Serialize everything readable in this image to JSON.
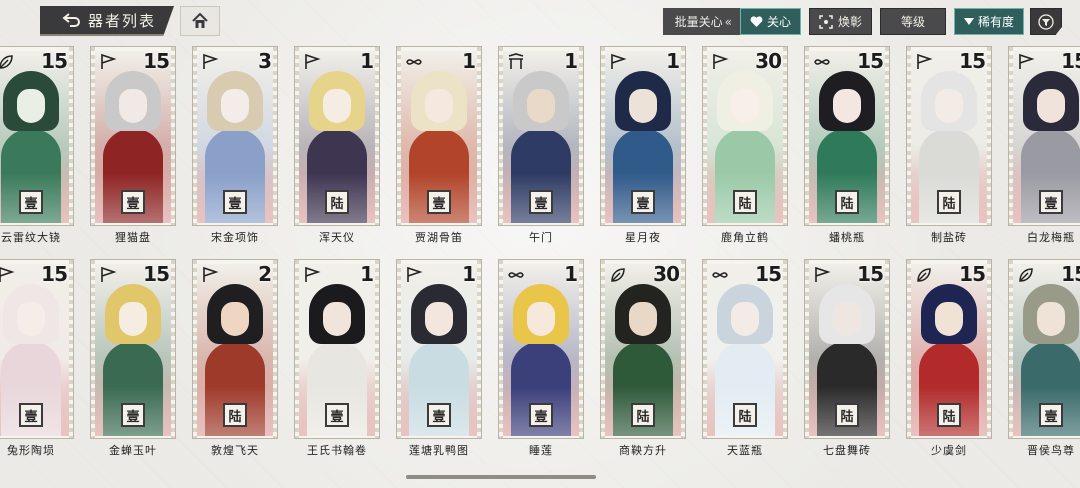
{
  "header": {
    "title": "器者列表",
    "batch_label": "批量关心",
    "batch_chevron": "«",
    "fav_label": "关心",
    "swap_label": "焕彰",
    "level_label": "等级",
    "rarity_label": "稀有度"
  },
  "icons": {
    "back": "back-arrow-icon",
    "home": "home-icon",
    "heart": "heart-icon",
    "swap": "swap-frame-icon",
    "filter": "filter-icon"
  },
  "colors": {
    "accent_teal": "#2f5e5c",
    "dark_button": "#4a4a4c",
    "background": "#ecebe7"
  },
  "cards": [
    {
      "name": "云雷纹大铙",
      "level": "15",
      "grade": "壹",
      "type": "leaf",
      "palette": [
        "#2a4a3a",
        "#e9efe5",
        "#3a7a5a"
      ]
    },
    {
      "name": "狸猫盘",
      "level": "15",
      "grade": "壹",
      "type": "flag",
      "palette": [
        "#c9c9c9",
        "#f0e9e6",
        "#8e2424"
      ]
    },
    {
      "name": "宋金项饰",
      "level": "3",
      "grade": "壹",
      "type": "flag",
      "palette": [
        "#d8cbb0",
        "#f3ece8",
        "#8aa0c9"
      ]
    },
    {
      "name": "浑天仪",
      "level": "1",
      "grade": "陆",
      "type": "flag",
      "palette": [
        "#e6d48a",
        "#f5ece4",
        "#3e3550"
      ]
    },
    {
      "name": "贾湖骨笛",
      "level": "1",
      "grade": "壹",
      "type": "knot",
      "palette": [
        "#ece2c6",
        "#f5e8de",
        "#b2442a"
      ]
    },
    {
      "name": "午门",
      "level": "1",
      "grade": "壹",
      "type": "gate",
      "palette": [
        "#c9c9c9",
        "#e9d9c8",
        "#2e3b64"
      ]
    },
    {
      "name": "星月夜",
      "level": "1",
      "grade": "壹",
      "type": "flag",
      "palette": [
        "#1f2a48",
        "#ede2d8",
        "#2f5a8a"
      ]
    },
    {
      "name": "鹿角立鹤",
      "level": "30",
      "grade": "陆",
      "type": "flag",
      "palette": [
        "#f0efe4",
        "#f7efe8",
        "#9bc9a8"
      ]
    },
    {
      "name": "蟠桃瓶",
      "level": "15",
      "grade": "陆",
      "type": "knot",
      "palette": [
        "#1e1e22",
        "#f4e6e0",
        "#2f7a5a"
      ]
    },
    {
      "name": "制盐砖",
      "level": "15",
      "grade": "陆",
      "type": "flag",
      "palette": [
        "#e4e4e4",
        "#f2ebe6",
        "#dadad6"
      ]
    },
    {
      "name": "白龙梅瓶",
      "level": "15",
      "grade": "壹",
      "type": "flag",
      "palette": [
        "#2a2a3a",
        "#efe3dc",
        "#9a9aa2"
      ]
    },
    {
      "name": "兔形陶埙",
      "level": "15",
      "grade": "壹",
      "type": "flag",
      "palette": [
        "#efe6e6",
        "#f6ece8",
        "#e8d6da"
      ]
    },
    {
      "name": "金蝉玉叶",
      "level": "15",
      "grade": "壹",
      "type": "flag",
      "palette": [
        "#e2c66a",
        "#f5ece2",
        "#3a6a52"
      ]
    },
    {
      "name": "敦煌飞天",
      "level": "2",
      "grade": "陆",
      "type": "flag",
      "palette": [
        "#1f1f22",
        "#efd6c2",
        "#9e3a2a"
      ]
    },
    {
      "name": "王氏书翰卷",
      "level": "1",
      "grade": "壹",
      "type": "flag",
      "palette": [
        "#1b1b1d",
        "#f1e4da",
        "#e8e6e0"
      ]
    },
    {
      "name": "莲塘乳鸭图",
      "level": "1",
      "grade": "壹",
      "type": "flag",
      "palette": [
        "#2a2a32",
        "#f3e6de",
        "#c8dce2"
      ]
    },
    {
      "name": "睡莲",
      "level": "1",
      "grade": "壹",
      "type": "knot",
      "palette": [
        "#e9c64a",
        "#f6e9dc",
        "#3b3f7a"
      ]
    },
    {
      "name": "商鞅方升",
      "level": "30",
      "grade": "陆",
      "type": "leaf",
      "palette": [
        "#23231f",
        "#ead8c6",
        "#2f5a3a"
      ]
    },
    {
      "name": "天蓝瓶",
      "level": "15",
      "grade": "陆",
      "type": "knot",
      "palette": [
        "#c9d4dc",
        "#f3ebe6",
        "#e2ecf2"
      ]
    },
    {
      "name": "七盘舞砖",
      "level": "15",
      "grade": "陆",
      "type": "flag",
      "palette": [
        "#e6e6e6",
        "#efe6e2",
        "#2a2a2a"
      ]
    },
    {
      "name": "少虞剑",
      "level": "15",
      "grade": "陆",
      "type": "leaf",
      "palette": [
        "#1f2552",
        "#f1e2d6",
        "#b22a2a"
      ]
    },
    {
      "name": "晋侯鸟尊",
      "level": "15",
      "grade": "壹",
      "type": "leaf",
      "palette": [
        "#9a9a88",
        "#efe2d6",
        "#3a6a6a"
      ]
    }
  ]
}
